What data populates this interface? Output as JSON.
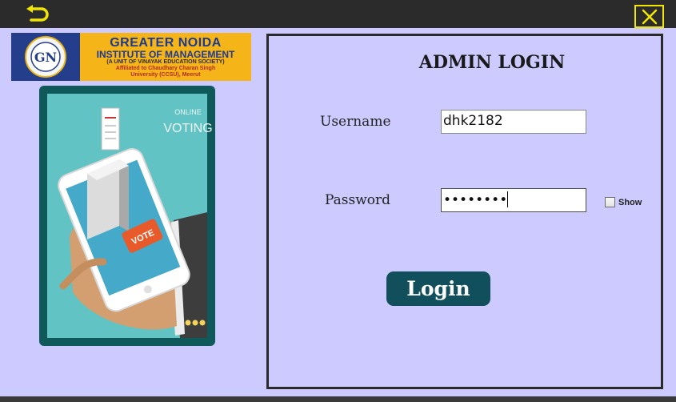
{
  "titlebar": {
    "back_icon": "back-arrow-icon",
    "close_icon": "close-icon",
    "accent": "#f2e600"
  },
  "logo": {
    "emblem_letters": "GN",
    "line1": "GREATER NOIDA",
    "line2": "INSTITUTE OF MANAGEMENT",
    "line3": "(A UNIT OF VINAYAK EDUCATION SOCIETY)",
    "line4": "Affiliated to Chaudhary Charan Singh",
    "line5": "University (CCSU), Meerut"
  },
  "illustration": {
    "line1": "ONLINE",
    "line2": "VOTING",
    "badge": "VOTE"
  },
  "panel": {
    "heading": "ADMIN LOGIN",
    "username_label": "Username",
    "username_value": "dhk2182",
    "password_label": "Password",
    "password_value": "••••••••",
    "show_label": "Show",
    "show_checked": false,
    "login_label": "Login"
  },
  "colors": {
    "background": "#cccaff",
    "button": "#104f5b",
    "logo_bg": "#f5b418",
    "logo_blue": "#1d3a8f"
  }
}
